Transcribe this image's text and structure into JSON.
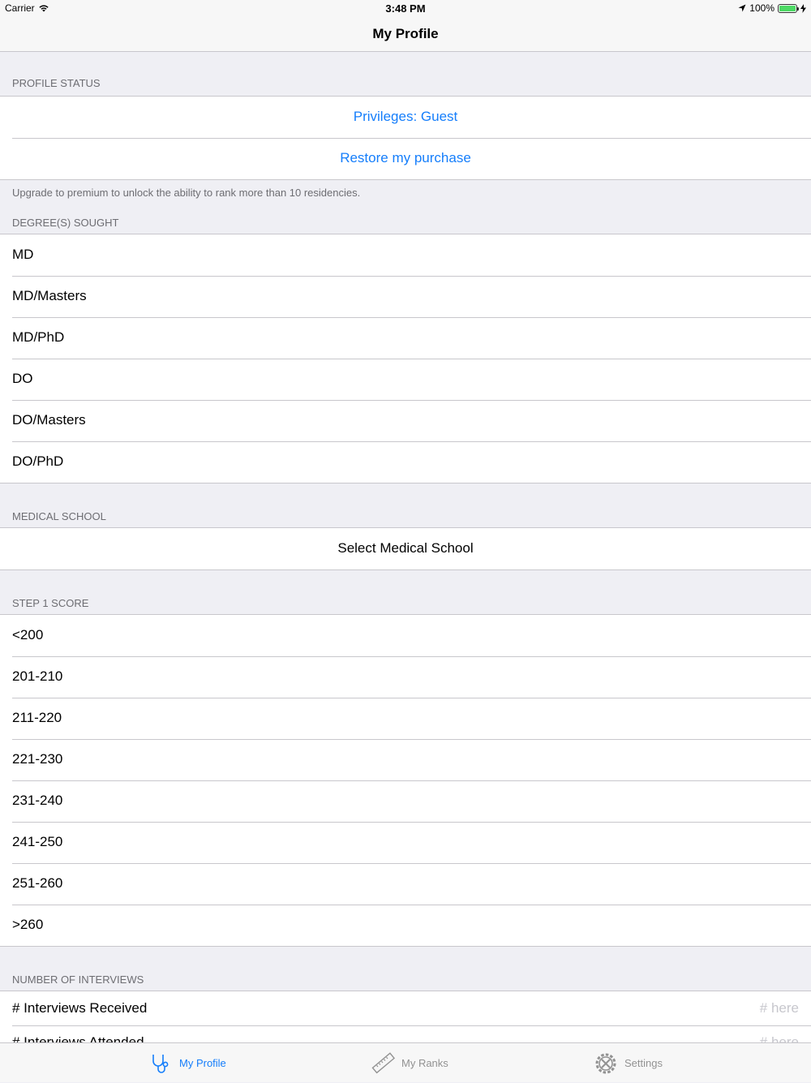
{
  "status_bar": {
    "carrier": "Carrier",
    "time": "3:48 PM",
    "battery": "100%"
  },
  "nav": {
    "title": "My Profile"
  },
  "profile_status": {
    "header": "PROFILE STATUS",
    "privileges": "Privileges: Guest",
    "restore": "Restore my purchase",
    "footer": "Upgrade to premium to unlock the ability to rank more than 10 residencies."
  },
  "degrees": {
    "header": "DEGREE(S) SOUGHT",
    "items": [
      {
        "label": "MD"
      },
      {
        "label": "MD/Masters"
      },
      {
        "label": "MD/PhD"
      },
      {
        "label": "DO"
      },
      {
        "label": "DO/Masters"
      },
      {
        "label": "DO/PhD"
      }
    ]
  },
  "medical_school": {
    "header": "MEDICAL SCHOOL",
    "select": "Select Medical School"
  },
  "step1": {
    "header": "STEP 1 SCORE",
    "items": [
      {
        "label": "<200"
      },
      {
        "label": "201-210"
      },
      {
        "label": "211-220"
      },
      {
        "label": "221-230"
      },
      {
        "label": "231-240"
      },
      {
        "label": "241-250"
      },
      {
        "label": "251-260"
      },
      {
        "label": ">260"
      }
    ]
  },
  "interviews": {
    "header": "NUMBER OF INTERVIEWS",
    "received_label": "# Interviews Received",
    "received_placeholder": "# here",
    "attended_label": "# Interviews Attended",
    "attended_placeholder": "# here"
  },
  "tabs": [
    {
      "label": "My Profile",
      "icon": "stethoscope-icon",
      "active": true
    },
    {
      "label": "My Ranks",
      "icon": "ruler-icon",
      "active": false
    },
    {
      "label": "Settings",
      "icon": "gear-tools-icon",
      "active": false
    }
  ],
  "colors": {
    "accent": "#157efb",
    "background": "#efeff4",
    "separator": "#c8c7cc"
  }
}
